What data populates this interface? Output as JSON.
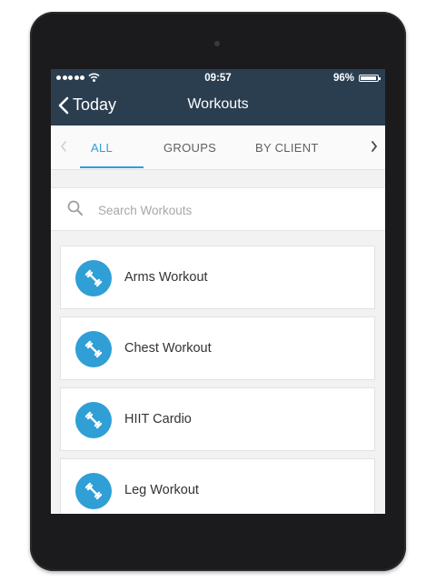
{
  "status_bar": {
    "time": "09:57",
    "battery": "96%",
    "battery_level": 0.96,
    "signal_icon": "signal-dots-icon",
    "wifi_icon": "wifi-icon"
  },
  "nav": {
    "back_label": "Today",
    "title": "Workouts"
  },
  "tabs": [
    {
      "label": "ALL",
      "active": true
    },
    {
      "label": "GROUPS",
      "active": false
    },
    {
      "label": "BY CLIENT",
      "active": false
    }
  ],
  "search": {
    "placeholder": "Search Workouts",
    "value": ""
  },
  "workouts": [
    {
      "label": "Arms Workout",
      "icon": "dumbbell-icon"
    },
    {
      "label": "Chest Workout",
      "icon": "dumbbell-icon"
    },
    {
      "label": "HIIT Cardio",
      "icon": "dumbbell-icon"
    },
    {
      "label": "Leg Workout",
      "icon": "dumbbell-icon"
    }
  ],
  "colors": {
    "header": "#2b3e50",
    "accent": "#2f9fd6",
    "background": "#f2f2f2"
  }
}
